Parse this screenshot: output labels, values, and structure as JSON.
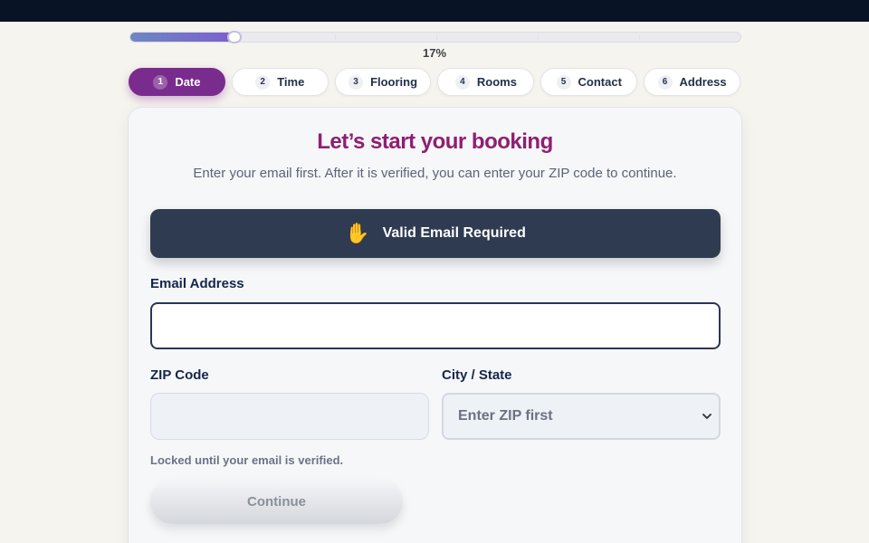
{
  "progress": {
    "percent_label": "17%",
    "fraction": 0.17
  },
  "steps": [
    {
      "num": "1",
      "label": "Date",
      "active": true
    },
    {
      "num": "2",
      "label": "Time",
      "active": false
    },
    {
      "num": "3",
      "label": "Flooring",
      "active": false
    },
    {
      "num": "4",
      "label": "Rooms",
      "active": false
    },
    {
      "num": "5",
      "label": "Contact",
      "active": false
    },
    {
      "num": "6",
      "label": "Address",
      "active": false
    }
  ],
  "card": {
    "title": "Let’s start your booking",
    "subtitle": "Enter your email first. After it is verified, you can enter your ZIP code to continue.",
    "notice": {
      "icon": "raised-hand-icon",
      "emoji": "✋",
      "text": "Valid Email Required"
    },
    "email": {
      "label": "Email Address",
      "value": "",
      "placeholder": ""
    },
    "zip": {
      "label": "ZIP Code",
      "value": "",
      "placeholder": ""
    },
    "city": {
      "label": "City / State",
      "selected": "Enter ZIP first"
    },
    "hint": "Locked until your email is verified.",
    "continue_label": "Continue"
  },
  "colors": {
    "accent": "#7a2c8e",
    "title": "#8e1f72",
    "notice_bg": "#2f3b50",
    "topbar": "#081425"
  }
}
